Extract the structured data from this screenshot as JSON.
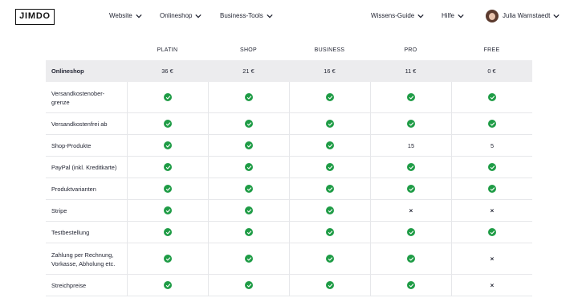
{
  "header": {
    "logo": "JIMDO",
    "nav": [
      {
        "label": "Website"
      },
      {
        "label": "Onlineshop"
      },
      {
        "label": "Business-Tools"
      }
    ],
    "right_nav": [
      {
        "label": "Wissens-Guide"
      },
      {
        "label": "Hilfe"
      }
    ],
    "user_name": "Julia Warnstaedt"
  },
  "plans": [
    "PLATIN",
    "SHOP",
    "BUSINESS",
    "PRO",
    "FREE"
  ],
  "section": {
    "title": "Onlineshop",
    "prices": [
      "36 €",
      "21 €",
      "16 €",
      "11 €",
      "0 €"
    ]
  },
  "rows": [
    {
      "label": "Versandkostenober-grenze",
      "label_lines": [
        "Versandkostenober-",
        "grenze"
      ],
      "values": [
        "check",
        "check",
        "check",
        "check",
        "check"
      ]
    },
    {
      "label": "Versandkostenfrei ab",
      "label_lines": [
        "Versandkostenfrei ab"
      ],
      "values": [
        "check",
        "check",
        "check",
        "check",
        "check"
      ]
    },
    {
      "label": "Shop-Produkte",
      "label_lines": [
        "Shop-Produkte"
      ],
      "values": [
        "check",
        "check",
        "check",
        "15",
        "5"
      ]
    },
    {
      "label": "PayPal (inkl. Kreditkarte)",
      "label_lines": [
        "PayPal (inkl. Kreditkarte)"
      ],
      "values": [
        "check",
        "check",
        "check",
        "check",
        "check"
      ]
    },
    {
      "label": "Produktvarianten",
      "label_lines": [
        "Produktvarianten"
      ],
      "values": [
        "check",
        "check",
        "check",
        "check",
        "check"
      ]
    },
    {
      "label": "Stripe",
      "label_lines": [
        "Stripe"
      ],
      "values": [
        "check",
        "check",
        "check",
        "×",
        "×"
      ]
    },
    {
      "label": "Testbestellung",
      "label_lines": [
        "Testbestellung"
      ],
      "values": [
        "check",
        "check",
        "check",
        "check",
        "check"
      ]
    },
    {
      "label": "Zahlung per Rechnung, Vorkasse, Abholung etc.",
      "label_lines": [
        "Zahlung per Rechnung,",
        "Vorkasse, Abholung etc."
      ],
      "values": [
        "check",
        "check",
        "check",
        "check",
        "×"
      ]
    },
    {
      "label": "Streichpreise",
      "label_lines": [
        "Streichpreise"
      ],
      "values": [
        "check",
        "check",
        "check",
        "check",
        "×"
      ]
    }
  ],
  "colors": {
    "check": "#1f9c46",
    "section_bg": "#ececee"
  }
}
